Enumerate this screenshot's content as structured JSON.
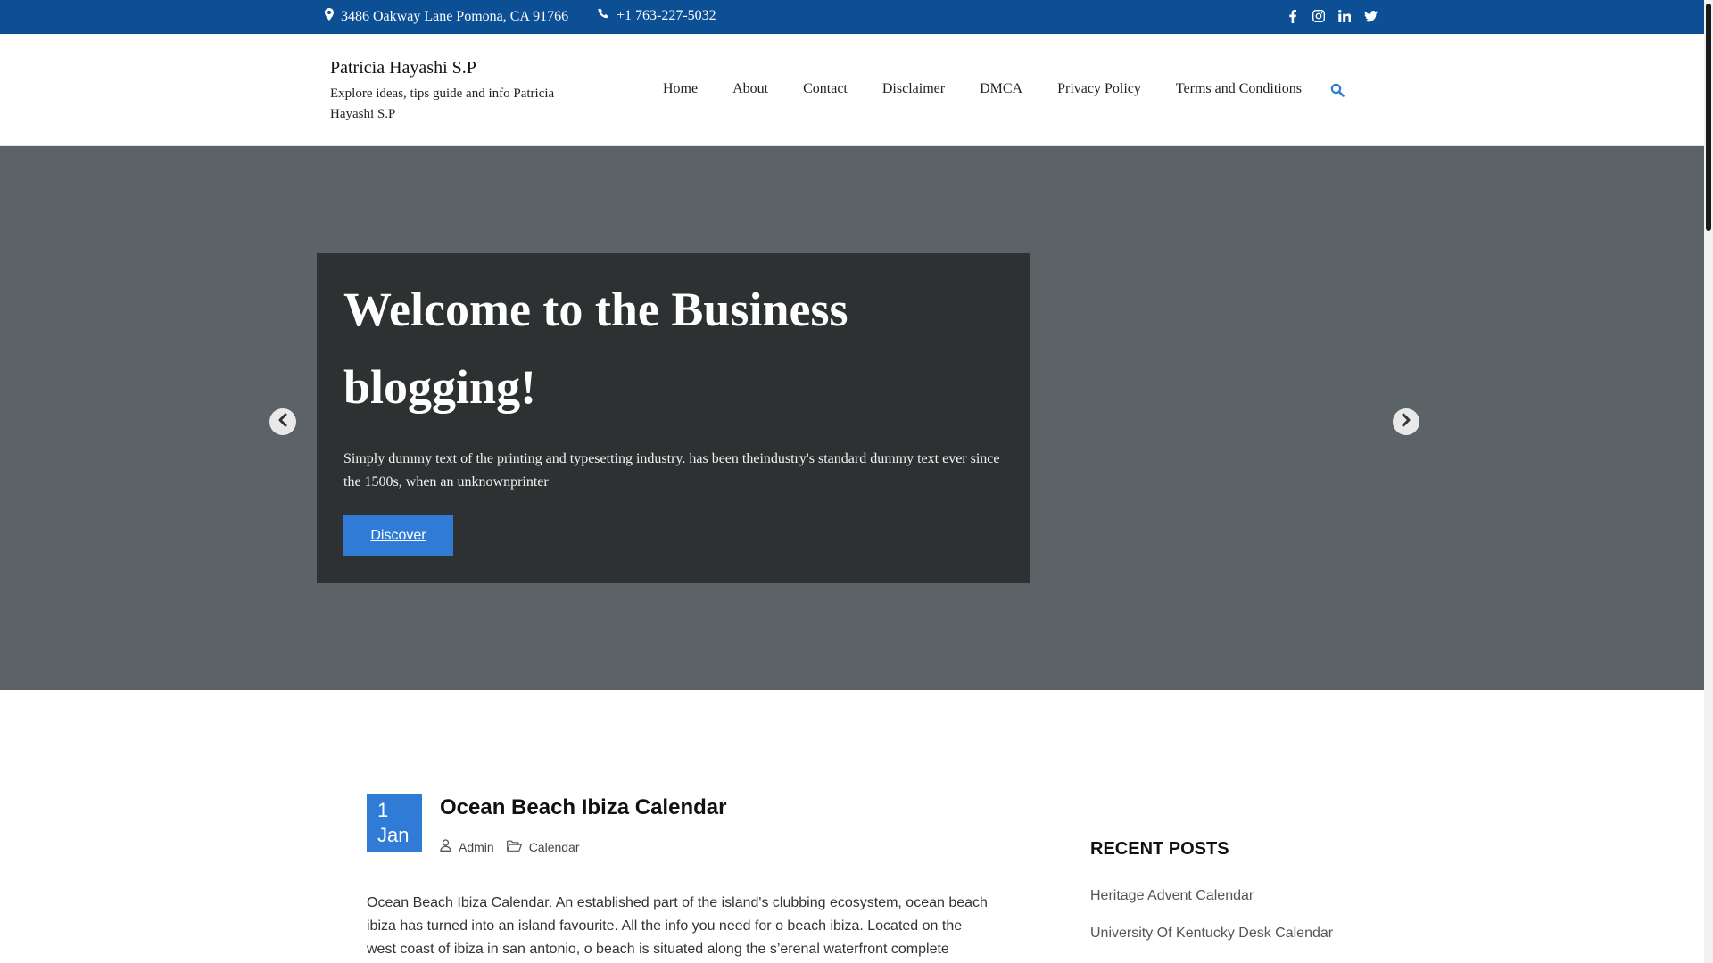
{
  "topbar": {
    "address": "3486 Oakway Lane Pomona, CA 91766",
    "phone": "+1 763-227-5032",
    "social": [
      "facebook-icon",
      "instagram-icon",
      "linkedin-icon",
      "twitter-icon"
    ]
  },
  "site": {
    "name": "Patricia Hayashi S.P",
    "tagline": "Explore ideas, tips guide and info Patricia Hayashi S.P"
  },
  "nav": {
    "items": [
      "Home",
      "About",
      "Contact",
      "Disclaimer",
      "DMCA",
      "Privacy Policy",
      "Terms and Conditions"
    ]
  },
  "hero": {
    "title": "Welcome to the Business blogging!",
    "text": "Simply dummy text of the printing and typesetting industry. has been theindustry's standard dummy text ever since the 1500s, when an unknownprinter",
    "button": "Discover"
  },
  "post": {
    "day": "1",
    "month": "Jan",
    "title": "Ocean Beach Ibiza Calendar",
    "author": "Admin",
    "category": "Calendar",
    "excerpt": "Ocean Beach Ibiza Calendar. An established part of the island's clubbing ecosystem, ocean beach ibiza has turned into an island favourite. All the info you need for o beach ibiza. Located on the west coast of ibiza in san antonio, o beach is situated along the s’erenal waterfront complete"
  },
  "sidebar": {
    "title": "RECENT POSTS",
    "items": [
      "Heritage Advent Calendar",
      "University Of Kentucky Desk Calendar"
    ]
  },
  "colors": {
    "topbar": "#0d4f95",
    "accent": "#2f7bd6",
    "hero_bg": "#5b6366",
    "hero_box": "#2e3132"
  }
}
